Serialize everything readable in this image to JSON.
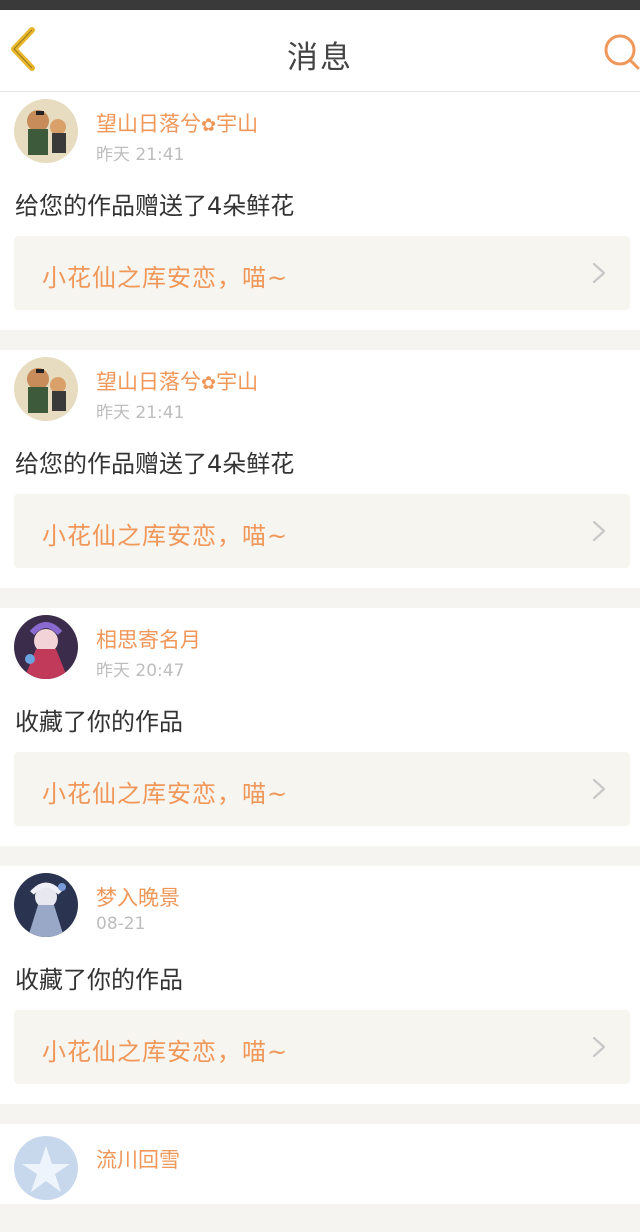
{
  "header": {
    "title": "消息",
    "back_icon": "chevron-left-icon",
    "search_icon": "search-icon",
    "accent_color": "#f7c232"
  },
  "messages": [
    {
      "user": "望山日落兮",
      "flower": "✿",
      "user_suffix": "宇山",
      "time": "昨天 21:41",
      "action": "给您的作品赠送了4朵鲜花",
      "work": "小花仙之库安恋，喵~",
      "avatar": "avatar-1"
    },
    {
      "user": "望山日落兮",
      "flower": "✿",
      "user_suffix": "宇山",
      "time": "昨天 21:41",
      "action": "给您的作品赠送了4朵鲜花",
      "work": "小花仙之库安恋，喵~",
      "avatar": "avatar-1"
    },
    {
      "user": "相思寄名月",
      "flower": "",
      "user_suffix": "",
      "time": "昨天 20:47",
      "action": "收藏了你的作品",
      "work": "小花仙之库安恋，喵~",
      "avatar": "avatar-2"
    },
    {
      "user": "梦入晚景",
      "flower": "",
      "user_suffix": "",
      "time": "08-21",
      "action": "收藏了你的作品",
      "work": "小花仙之库安恋，喵~",
      "avatar": "avatar-3"
    },
    {
      "user": "流川回雪",
      "flower": "",
      "user_suffix": "",
      "time": "",
      "action": "",
      "work": "",
      "avatar": "avatar-4"
    }
  ],
  "colors": {
    "name": "#f0975a",
    "time": "#bdbdbd",
    "link_bg": "#f6f5ef",
    "page_bg": "#f6f4f0"
  }
}
